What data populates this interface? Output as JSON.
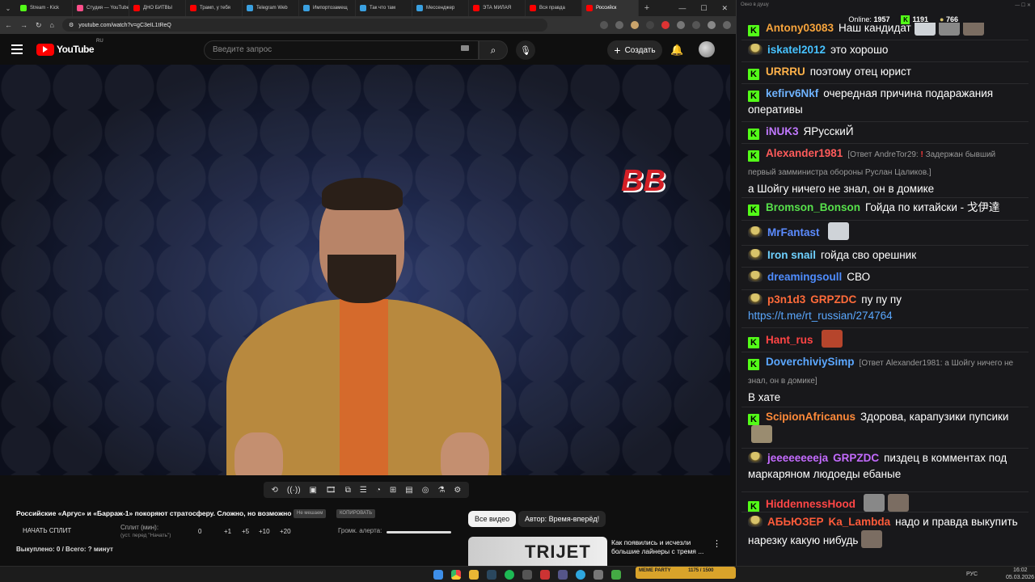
{
  "browser": {
    "tabs": [
      {
        "label": "Stream - Kick",
        "color": "#53fc18"
      },
      {
        "label": "Студия — YouTube",
        "color": "#ff4e8a"
      },
      {
        "label": "ДНО БИТВЫ",
        "color": "#ff0000"
      },
      {
        "label": "Трамп, у тебя",
        "color": "#ff0000"
      },
      {
        "label": "Telegram Web",
        "color": "#3aa0e0"
      },
      {
        "label": "Импортозамещ",
        "color": "#3aa0e0"
      },
      {
        "label": "Так что там",
        "color": "#3aa0e0"
      },
      {
        "label": "Мессенджер",
        "color": "#3aa0e0"
      },
      {
        "label": "ЭТА МИЛАЯ",
        "color": "#ff0000"
      },
      {
        "label": "Вся правда",
        "color": "#ff0000"
      },
      {
        "label": "Российск",
        "color": "#ff0000",
        "active": true
      }
    ],
    "url": "youtube.com/watch?v=gC3eIL1tReQ"
  },
  "youtube": {
    "region": "RU",
    "logo_text": "YouTube",
    "search_placeholder": "Введите запрос",
    "create_label": "Создать"
  },
  "video": {
    "logo_text": "BB",
    "title": "Российские «Аргус» и «Барраж-1» покоряют стратосферу. Сложно, но возможно",
    "pill_1": "Не мешаем",
    "pill_2": "КОПИРОВАТЬ",
    "split_button": "НАЧАТЬ СПЛИТ",
    "split_label": "Сплит (мин):",
    "split_hint": "(уст. перед \"Начать\")",
    "split_values": [
      "0",
      "+1",
      "+5",
      "+10",
      "+20"
    ],
    "alert_label": "Громк. алерта:",
    "payout": "Выкуплено: 0 / Всего: ? минут"
  },
  "recs": {
    "chip_all": "Все видео",
    "chip_author": "Автор: Время-вперёд!",
    "thumb_text": "TRIJET",
    "title": "Как появились и исчезли большие лайнеры с тремя ..."
  },
  "chat": {
    "window_title": "Окно в душу",
    "online_label": "Online:",
    "online_count": "1957",
    "kick_count": "1191",
    "other_count": "766",
    "messages": [
      {
        "badge": "k",
        "user": "Antony03083",
        "color": "#f7a43c",
        "text": "Наш кандидат"
      },
      {
        "badge": "h",
        "user": "iskatel2012",
        "color": "#47c2ff",
        "text": "это хорошо"
      },
      {
        "badge": "k",
        "user": "URRRU",
        "color": "#ffb24a",
        "text": "поэтому отец юрист"
      },
      {
        "badge": "k",
        "user": "kefirv6Nkf",
        "color": "#6fb3ff",
        "text": "очередная причина подаражания оперативы"
      },
      {
        "badge": "k",
        "user": "iNUK3",
        "color": "#c178ff",
        "text": "ЯРусскиЙ"
      },
      {
        "badge": "k",
        "user": "Alexander1981",
        "color": "#ff5b5b",
        "reply": "[Ответ AndreTor29:",
        "reply2": "Задержан бывший первый замминистра обороны Руслан Цаликов.]",
        "text": "а Шойгу ничего не знал, он в домике"
      },
      {
        "badge": "k",
        "user": "Bromson_Bonson",
        "color": "#57e04b",
        "text": "Гойда по китайски - 戈伊達"
      },
      {
        "badge": "h",
        "user": "MrFantast",
        "color": "#5b8bff",
        "text": ""
      },
      {
        "badge": "h",
        "user": "Iron snail",
        "color": "#6fd1ff",
        "text": "гойда сво орешник"
      },
      {
        "badge": "h",
        "user": "dreamingsoull",
        "color": "#4f8dff",
        "text": "СВО"
      },
      {
        "badge": "h",
        "user": "p3n1d3",
        "color": "#ff6b3a",
        "mention": "GRPZDC",
        "text": "пу пу пу",
        "link": "https://t.me/rt_russian/274764"
      },
      {
        "badge": "k",
        "user": "Hant_rus",
        "color": "#ff4444",
        "text": ""
      },
      {
        "badge": "k",
        "user": "DoverchiviySimp",
        "color": "#5ba7ff",
        "reply": "[Ответ Alexander1981: а Шойгу ничего не знал, он в домике]",
        "text": "В хате"
      },
      {
        "badge": "k",
        "user": "ScipionAfricanus",
        "color": "#ff8a3a",
        "text": "Здорова, карапузики пупсики"
      },
      {
        "badge": "h",
        "user": "jeeeeeeeeja",
        "color": "#c46bff",
        "mention": "GRPZDC",
        "text": "пиздец в комментах под маркаряном людоеды ебаные"
      },
      {
        "badge": "k",
        "user": "HiddennessHood",
        "color": "#ff4646",
        "text": ""
      },
      {
        "badge": "h",
        "user": "АБЬЮЗЕР",
        "color": "#ff5b3a",
        "mention": "Ka_Lambda",
        "text": "надо и правда выкупить нарезку какую нибудь"
      }
    ]
  },
  "taskbar": {
    "meme_label": "MEME PARTY",
    "meme_value": "1175 / 1500",
    "lang": "РУС",
    "time": "16:02",
    "date": "05.03.2026"
  }
}
